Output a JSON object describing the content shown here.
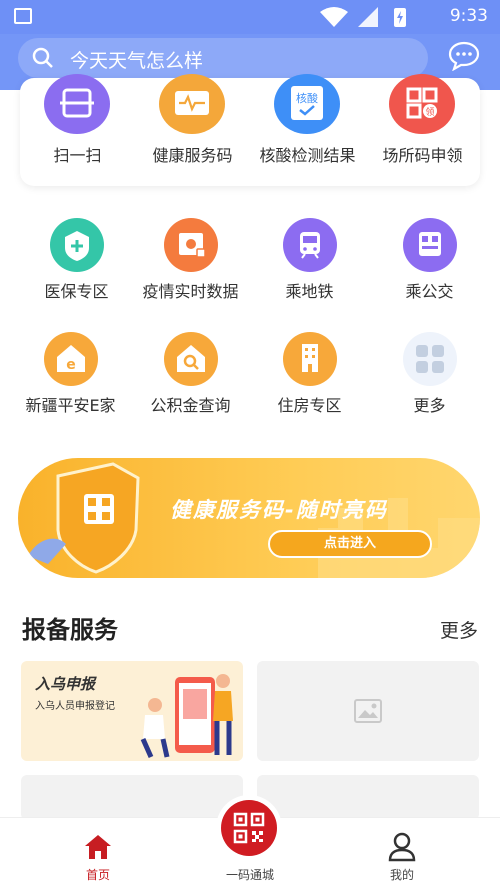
{
  "status_bar": {
    "time": "9:33"
  },
  "search": {
    "placeholder": "今天天气怎么样"
  },
  "top_services": [
    {
      "label": "扫一扫",
      "icon": "scan-icon",
      "color": "#8b6df0"
    },
    {
      "label": "健康服务码",
      "icon": "health-code-icon",
      "color": "#f4a73a"
    },
    {
      "label": "核酸检测结果",
      "icon": "nucleic-test-icon",
      "color": "#3e8ff7",
      "icon_text": "核酸"
    },
    {
      "label": "场所码申领",
      "icon": "venue-code-icon",
      "color": "#f0564d",
      "icon_text": "领"
    }
  ],
  "grid": [
    {
      "label": "医保专区",
      "icon": "medical-insurance-icon",
      "color": "#34c6a8"
    },
    {
      "label": "疫情实时数据",
      "icon": "epidemic-data-icon",
      "color": "#f47b3e"
    },
    {
      "label": "乘地铁",
      "icon": "metro-icon",
      "color": "#8c6cf1"
    },
    {
      "label": "乘公交",
      "icon": "bus-icon",
      "color": "#8c6cf1"
    },
    {
      "label": "新疆平安E家",
      "icon": "safe-home-icon",
      "color": "#f7a83a"
    },
    {
      "label": "公积金查询",
      "icon": "housing-fund-icon",
      "color": "#f7a83a"
    },
    {
      "label": "住房专区",
      "icon": "housing-icon",
      "color": "#f7a83a"
    },
    {
      "label": "更多",
      "icon": "more-grid-icon",
      "color": "#dfe7f3"
    }
  ],
  "banner": {
    "title": "健康服务码-随时亮码",
    "cta": "点击进入"
  },
  "section": {
    "title": "报备服务",
    "more": "更多",
    "card1_title": "入乌申报",
    "card1_subtitle": "入乌人员申报登记"
  },
  "bottom_nav": [
    {
      "label": "首页",
      "icon": "home-icon",
      "active": true
    },
    {
      "label": "一码通城",
      "icon": "qr-code-icon",
      "active": false
    },
    {
      "label": "我的",
      "icon": "profile-icon",
      "active": false
    }
  ],
  "colors": {
    "header": "#7496f7",
    "accent_red": "#c71d22",
    "banner": "#f9b22b"
  }
}
